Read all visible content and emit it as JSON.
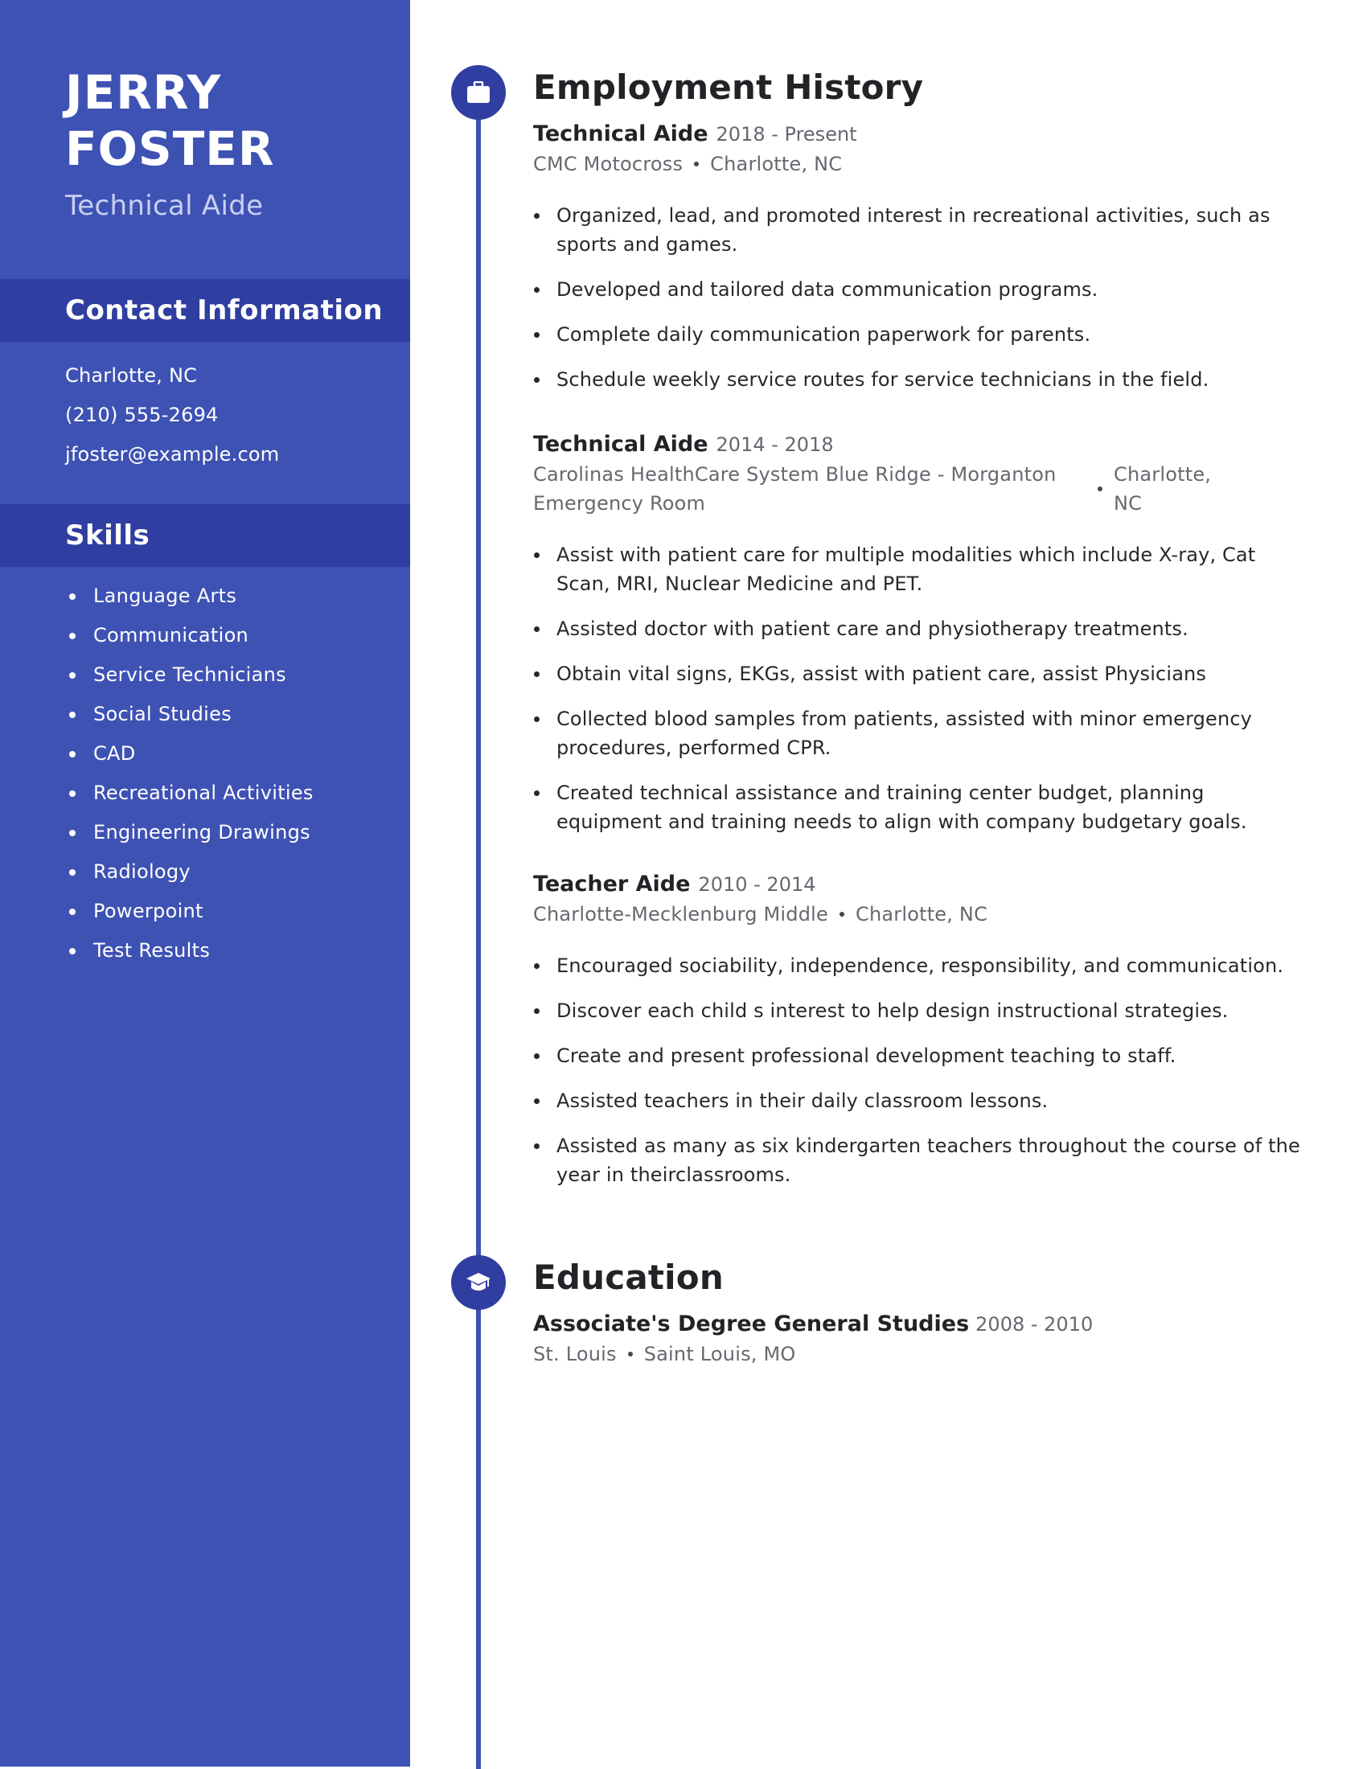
{
  "profile": {
    "first_name": "JERRY",
    "last_name": "FOSTER",
    "title": "Technical Aide"
  },
  "contact": {
    "heading": "Contact Information",
    "items": [
      "Charlotte, NC",
      "(210) 555-2694",
      "jfoster@example.com"
    ]
  },
  "skills": {
    "heading": "Skills",
    "items": [
      "Language Arts",
      "Communication",
      "Service Technicians",
      "Social Studies",
      "CAD",
      "Recreational Activities",
      "Engineering Drawings",
      "Radiology",
      "Powerpoint",
      "Test Results"
    ]
  },
  "employment": {
    "heading": "Employment History",
    "icon": "briefcase-icon",
    "jobs": [
      {
        "title": "Technical Aide",
        "dates": "2018 - Present",
        "employer": "CMC Motocross",
        "location": "Charlotte, NC",
        "bullets": [
          "Organized, lead, and promoted interest in recreational activities, such as sports and games.",
          "Developed and tailored data communication programs.",
          "Complete daily communication paperwork for parents.",
          "Schedule weekly service routes for service technicians in the field."
        ]
      },
      {
        "title": "Technical Aide",
        "dates": "2014 - 2018",
        "employer": "Carolinas HealthCare System Blue Ridge - Morganton Emergency Room",
        "location": "Charlotte, NC",
        "bullets": [
          "Assist with patient care for multiple modalities which include X-ray, Cat Scan, MRI, Nuclear Medicine and PET.",
          "Assisted doctor with patient care and physiotherapy treatments.",
          "Obtain vital signs, EKGs, assist with patient care, assist Physicians",
          "Collected blood samples from patients, assisted with minor emergency procedures, performed CPR.",
          "Created technical assistance and training center budget, planning equipment and training needs to align with company budgetary goals."
        ]
      },
      {
        "title": "Teacher Aide",
        "dates": "2010 - 2014",
        "employer": "Charlotte-Mecklenburg Middle",
        "location": "Charlotte, NC",
        "bullets": [
          "Encouraged sociability, independence, responsibility, and communication.",
          "Discover each child s interest to help design instructional strategies.",
          "Create and present professional development teaching to staff.",
          "Assisted teachers in their daily classroom lessons.",
          "Assisted as many as six kindergarten teachers throughout the course of the year in theirclassrooms."
        ]
      }
    ]
  },
  "education": {
    "heading": "Education",
    "icon": "graduation-cap-icon",
    "entries": [
      {
        "degree": "Associate's Degree General Studies",
        "dates": "2008 - 2010",
        "school": "St. Louis",
        "location": "Saint Louis, MO"
      }
    ]
  },
  "colors": {
    "sidebar": "#3e52b4",
    "band": "#2f3ea0",
    "accent": "#3e52b4",
    "subtitle": "#c9cff2",
    "text": "#222327",
    "muted": "#67686f"
  }
}
